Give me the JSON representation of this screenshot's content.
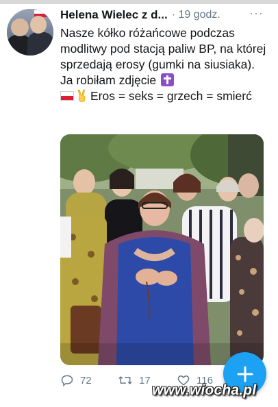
{
  "tweet": {
    "author": "Helena Wielec z d...",
    "time": "· 19 godz.",
    "more": "···",
    "text_main": "Nasze kółko różańcowe podczas modlitwy pod stacją paliw BP, na której sprzedają erosy (gumki na siusiaka). Ja robiłam zdjęcie",
    "text_end": "Eros = seks = grzech = smierć",
    "emojis": [
      "latin-cross-emoji",
      "poland-flag-emoji",
      "victory-hand-emoji"
    ]
  },
  "actions": {
    "reply_count": "72",
    "retweet_count": "17",
    "like_count": "116"
  },
  "fab": {
    "icon": "compose-plus-icon"
  },
  "watermark": "www.wiocha.pl",
  "colors": {
    "accent": "#1da1f2",
    "text": "#14171a",
    "muted": "#657786"
  }
}
